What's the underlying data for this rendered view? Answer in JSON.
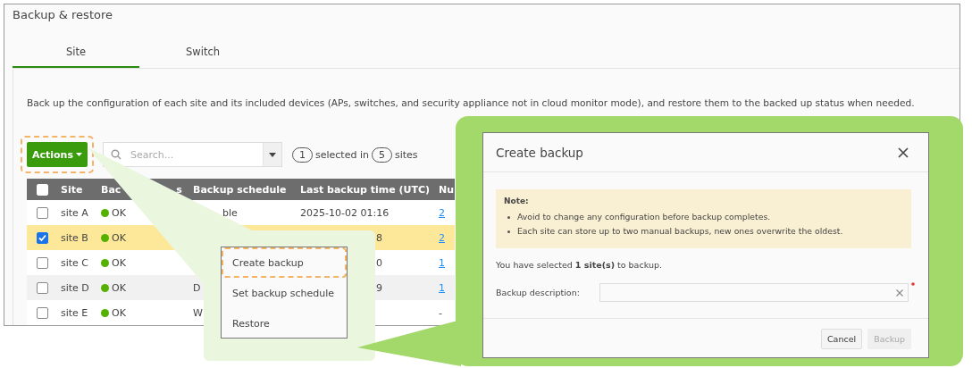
{
  "page": {
    "title": "Backup & restore"
  },
  "tabs": [
    {
      "label": "Site",
      "selected": true
    },
    {
      "label": "Switch",
      "selected": false
    }
  ],
  "description": "Back up the configuration of each site and its included devices (APs, switches, and security appliance not in cloud monitor mode), and restore them to the backed up status when needed.",
  "toolbar": {
    "actions": {
      "label": "Actions",
      "highlighted": true
    },
    "search": {
      "placeholder": "Search..."
    },
    "selected_count": "1",
    "selected_text": "selected in",
    "total_count": "5",
    "total_text": "sites"
  },
  "table": {
    "header_checked": false,
    "columns": [
      {
        "label": "Site"
      },
      {
        "label": "Bac",
        "tail": "s"
      },
      {
        "label": "Backup schedule"
      },
      {
        "label": "Last backup time (UTC)"
      },
      {
        "label": "Nu"
      }
    ],
    "rows": [
      {
        "checked": false,
        "site": "site A",
        "status": "OK",
        "schedule_tail": "ble",
        "last_backup": "2025-10-02 01:16",
        "count": "2",
        "count_link": true
      },
      {
        "checked": true,
        "site": "site B",
        "status": "OK",
        "last_tail": "8",
        "count": "2",
        "count_link": true
      },
      {
        "checked": false,
        "site": "site C",
        "status": "OK",
        "last_tail": "0",
        "count": "1",
        "count_link": true
      },
      {
        "checked": false,
        "site": "site D",
        "status": "OK",
        "schedule": "D",
        "last_tail": "9",
        "count": "1",
        "count_link": true
      },
      {
        "checked": false,
        "site": "site E",
        "status": "OK",
        "schedule": "W",
        "count": "-",
        "count_link": false
      }
    ]
  },
  "menu": {
    "items": [
      {
        "label": "Create backup",
        "highlighted": true
      },
      {
        "label": "Set backup schedule",
        "highlighted": false
      },
      {
        "label": "Restore",
        "highlighted": false
      }
    ]
  },
  "dialog": {
    "title": "Create backup",
    "note_title": "Note:",
    "notes": [
      "Avoid to change any configuration before backup completes.",
      "Each site can store up to two manual backups, new ones overwrite the oldest."
    ],
    "summary": "You have selected **1 site(s)** to backup.",
    "field_label": "Backup description:",
    "field_required": true,
    "buttons": [
      {
        "label": "Cancel",
        "disabled": false
      },
      {
        "label": "Backup",
        "disabled": true
      }
    ]
  }
}
